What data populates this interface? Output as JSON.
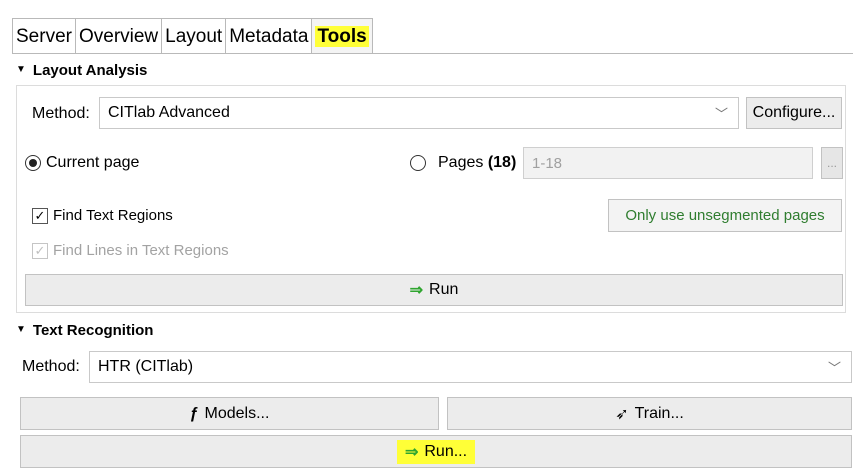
{
  "tabs": [
    "Server",
    "Overview",
    "Layout",
    "Metadata",
    "Tools"
  ],
  "active_tab": "Tools",
  "layout_analysis": {
    "title": "Layout Analysis",
    "method_label": "Method:",
    "method_value": "CITlab Advanced",
    "configure_label": "Configure...",
    "current_page_label": "Current page",
    "pages_label_prefix": "Pages ",
    "pages_count": "(18)",
    "pages_input_value": "1-18",
    "ellipsis_button": "...",
    "find_text_regions_label": "Find Text Regions",
    "find_lines_label": "Find Lines in Text Regions",
    "only_unsegmented_label": "Only use unsegmented pages",
    "run_label": "Run"
  },
  "text_recognition": {
    "title": "Text Recognition",
    "method_label": "Method:",
    "method_value": "HTR (CITlab)",
    "models_label": "Models...",
    "train_label": "Train...",
    "run_label": "Run..."
  },
  "colors": {
    "highlight": "#ffff37",
    "run_arrow": "#2fa52f",
    "unsegmented_text": "#2f7d2f"
  },
  "state": {
    "current_page_selected": true,
    "pages_selected": false,
    "find_text_regions_checked": true,
    "find_lines_checked": true,
    "find_lines_disabled": true
  }
}
